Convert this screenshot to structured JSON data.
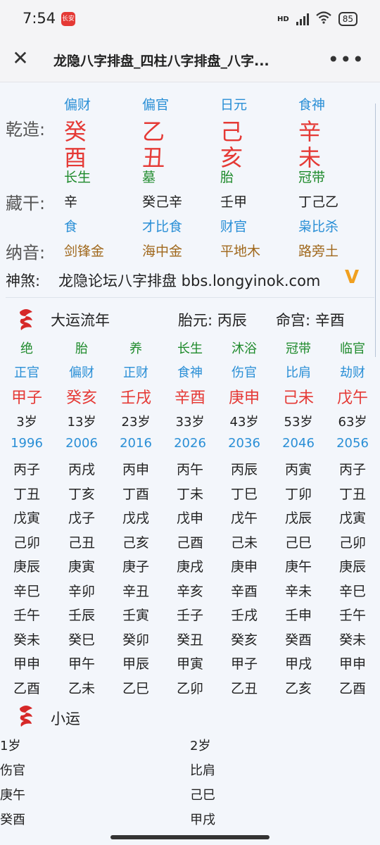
{
  "status": {
    "time": "7:54",
    "app_badge": "长安",
    "network": "HD",
    "battery": "85"
  },
  "header": {
    "title": "龙隐八字排盘_四柱八字排盘_八字..."
  },
  "chart": {
    "row1_label": "乾造:",
    "row2_label": "藏干:",
    "row3_label": "纳音:",
    "pillars": [
      {
        "top": "偏财",
        "gan": "癸",
        "zhi": "酉",
        "state": "长生",
        "cang": "辛",
        "cang_god": "食",
        "nayin": "剑锋金"
      },
      {
        "top": "偏官",
        "gan": "乙",
        "zhi": "丑",
        "state": "墓",
        "cang": "癸己辛",
        "cang_god": "才比食",
        "nayin": "海中金"
      },
      {
        "top": "日元",
        "gan": "己",
        "zhi": "亥",
        "state": "胎",
        "cang": "壬甲",
        "cang_god": "财官",
        "nayin": "平地木"
      },
      {
        "top": "食神",
        "gan": "辛",
        "zhi": "未",
        "state": "冠带",
        "cang": "丁己乙",
        "cang_god": "枭比杀",
        "nayin": "路旁土"
      }
    ],
    "shensha_label": "神煞:",
    "shensha_text": "龙隐论坛八字排盘 bbs.longyinok.com",
    "expand_icon": "V"
  },
  "dayun": {
    "title": "大运流年",
    "taiyuan": "胎元: 丙辰",
    "minggong": "命宫: 辛酉",
    "columns": [
      {
        "state": "绝",
        "god": "正官",
        "pillar": "甲子",
        "age": "3岁",
        "year": "1996",
        "years": [
          "丙子",
          "丁丑",
          "戊寅",
          "己卯",
          "庚辰",
          "辛巳",
          "壬午",
          "癸未",
          "甲申",
          "乙酉"
        ]
      },
      {
        "state": "胎",
        "god": "偏财",
        "pillar": "癸亥",
        "age": "13岁",
        "year": "2006",
        "years": [
          "丙戌",
          "丁亥",
          "戊子",
          "己丑",
          "庚寅",
          "辛卯",
          "壬辰",
          "癸巳",
          "甲午",
          "乙未"
        ]
      },
      {
        "state": "养",
        "god": "正财",
        "pillar": "壬戌",
        "age": "23岁",
        "year": "2016",
        "years": [
          "丙申",
          "丁酉",
          "戊戌",
          "己亥",
          "庚子",
          "辛丑",
          "壬寅",
          "癸卯",
          "甲辰",
          "乙巳"
        ]
      },
      {
        "state": "长生",
        "god": "食神",
        "pillar": "辛酉",
        "age": "33岁",
        "year": "2026",
        "years": [
          "丙午",
          "丁未",
          "戊申",
          "己酉",
          "庚戌",
          "辛亥",
          "壬子",
          "癸丑",
          "甲寅",
          "乙卯"
        ]
      },
      {
        "state": "沐浴",
        "god": "伤官",
        "pillar": "庚申",
        "age": "43岁",
        "year": "2036",
        "years": [
          "丙辰",
          "丁巳",
          "戊午",
          "己未",
          "庚申",
          "辛酉",
          "壬戌",
          "癸亥",
          "甲子",
          "乙丑"
        ]
      },
      {
        "state": "冠带",
        "god": "比肩",
        "pillar": "己未",
        "age": "53岁",
        "year": "2046",
        "years": [
          "丙寅",
          "丁卯",
          "戊辰",
          "己巳",
          "庚午",
          "辛未",
          "壬申",
          "癸酉",
          "甲戌",
          "乙亥"
        ]
      },
      {
        "state": "临官",
        "god": "劫财",
        "pillar": "戊午",
        "age": "63岁",
        "year": "2056",
        "years": [
          "丙子",
          "丁丑",
          "戊寅",
          "己卯",
          "庚辰",
          "辛巳",
          "壬午",
          "癸未",
          "甲申",
          "乙酉"
        ]
      }
    ]
  },
  "xiaoyun": {
    "title": "小运",
    "cols": [
      {
        "age": "1岁",
        "god": "伤官",
        "gz": "庚午",
        "year_gz": "癸酉"
      },
      {
        "age": "2岁",
        "god": "比肩",
        "gz": "己巳",
        "year_gz": "甲戌"
      }
    ]
  },
  "colors": {
    "red": "#e53935",
    "blue": "#2a8fd6",
    "green": "#1e8a2b",
    "gold": "#a0681c"
  }
}
